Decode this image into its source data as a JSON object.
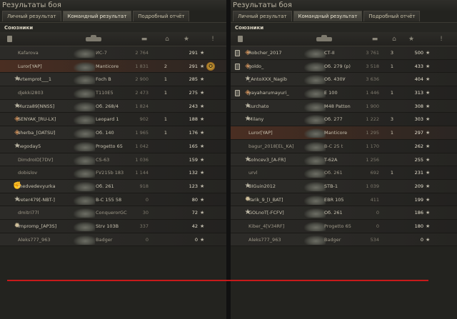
{
  "colors": {
    "accent": "#c81a1a",
    "self_row": "#4a2e22"
  },
  "left": {
    "title": "Результаты боя",
    "tabs": [
      "Личный результат",
      "Командный результат",
      "Подробный отчёт"
    ],
    "active_tab": 1,
    "team_label": "Союзники",
    "rows": [
      {
        "name": "Kafarova",
        "vehicle": "ИС-7",
        "dmg": "2 764",
        "kills": "",
        "xp": "291",
        "self": false,
        "dead": true,
        "icon": "none"
      },
      {
        "name": "Luror[YAP]",
        "vehicle": "Manticore",
        "dmg": "1 831",
        "kills": "2",
        "xp": "291",
        "self": true,
        "dead": false,
        "icon": "none",
        "medal": "1"
      },
      {
        "name": "Artemprot___1",
        "vehicle": "Foch B",
        "dmg": "2 900",
        "kills": "1",
        "xp": "285",
        "self": false,
        "dead": false,
        "icon": "star"
      },
      {
        "name": "djekki2803",
        "vehicle": "T110E5",
        "dmg": "2 473",
        "kills": "1",
        "xp": "275",
        "self": false,
        "dead": true,
        "icon": "none"
      },
      {
        "name": "Murza89[NNSS]",
        "vehicle": "Об. 268/4",
        "dmg": "1 824",
        "kills": "",
        "xp": "243",
        "self": false,
        "dead": false,
        "icon": "star"
      },
      {
        "name": "SENYAK_[RU-LX]",
        "vehicle": "Leopard 1",
        "dmg": "902",
        "kills": "1",
        "xp": "188",
        "self": false,
        "dead": false,
        "icon": "diamond"
      },
      {
        "name": "sherba_[OATSU]",
        "vehicle": "Об. 140",
        "dmg": "1 965",
        "kills": "1",
        "xp": "176",
        "self": false,
        "dead": false,
        "icon": "diamond"
      },
      {
        "name": "negoday5",
        "vehicle": "Progetto 65",
        "dmg": "1 042",
        "kills": "",
        "xp": "165",
        "self": false,
        "dead": false,
        "icon": "star"
      },
      {
        "name": "DimdroID[7DV]",
        "vehicle": "CS-63",
        "dmg": "1 036",
        "kills": "",
        "xp": "159",
        "self": false,
        "dead": true,
        "icon": "none"
      },
      {
        "name": "dobislov",
        "vehicle": "FV215b 183",
        "dmg": "1 144",
        "kills": "",
        "xp": "132",
        "self": false,
        "dead": true,
        "icon": "none"
      },
      {
        "name": "medvedevyurka",
        "vehicle": "Об. 261",
        "dmg": "918",
        "kills": "",
        "xp": "123",
        "self": false,
        "dead": false,
        "icon": "fist"
      },
      {
        "name": "veter479[-NBT-]",
        "vehicle": "B-C 155 58",
        "dmg": "0",
        "kills": "",
        "xp": "80",
        "self": false,
        "dead": false,
        "icon": "star"
      },
      {
        "name": "dmitri77l",
        "vehicle": "ConquerorGC",
        "dmg": "30",
        "kills": "",
        "xp": "72",
        "self": false,
        "dead": true,
        "icon": "none"
      },
      {
        "name": "Impromp_[AP3S]",
        "vehicle": "Strv 103B",
        "dmg": "337",
        "kills": "",
        "xp": "42",
        "self": false,
        "dead": false,
        "icon": "gear"
      },
      {
        "name": "Aleks777_963",
        "vehicle": "Badger",
        "dmg": "0",
        "kills": "",
        "xp": "0",
        "self": false,
        "dead": true,
        "icon": "none"
      }
    ]
  },
  "right": {
    "title": "Результаты боя",
    "tabs": [
      "Личный результат",
      "Командный результат",
      "Подробный отчёт"
    ],
    "active_tab": 1,
    "team_label": "Союзники",
    "rows": [
      {
        "name": "Robcher_2017",
        "vehicle": "СТ-II",
        "dmg": "3 761",
        "kills": "3",
        "xp": "500",
        "self": false,
        "dead": false,
        "icon": "diamond",
        "pi": true
      },
      {
        "name": "goldo_",
        "vehicle": "Об. 279 (р)",
        "dmg": "3 518",
        "kills": "1",
        "xp": "433",
        "self": false,
        "dead": false,
        "icon": "diamond",
        "pi": true
      },
      {
        "name": "_AntoXXX_Nagib",
        "vehicle": "Об. 430У",
        "dmg": "3 636",
        "kills": "",
        "xp": "404",
        "self": false,
        "dead": false,
        "icon": "star"
      },
      {
        "name": "yayaharumayuri_",
        "vehicle": "E 100",
        "dmg": "1 446",
        "kills": "1",
        "xp": "313",
        "self": false,
        "dead": false,
        "icon": "diamond",
        "pi": true
      },
      {
        "name": "kurchato",
        "vehicle": "M48 Patton",
        "dmg": "1 900",
        "kills": "",
        "xp": "308",
        "self": false,
        "dead": false,
        "icon": "star"
      },
      {
        "name": "Milany",
        "vehicle": "Об. 277",
        "dmg": "1 222",
        "kills": "3",
        "xp": "303",
        "self": false,
        "dead": false,
        "icon": "star"
      },
      {
        "name": "Luror[YAP]",
        "vehicle": "Manticore",
        "dmg": "1 295",
        "kills": "1",
        "xp": "297",
        "self": true,
        "dead": false,
        "icon": "none"
      },
      {
        "name": "bagur_2018[EL_KA]",
        "vehicle": "B-C 25 t",
        "dmg": "1 170",
        "kills": "",
        "xp": "262",
        "self": false,
        "dead": true,
        "icon": "none"
      },
      {
        "name": "solncev3_[A-FR]",
        "vehicle": "T-62A",
        "dmg": "1 256",
        "kills": "",
        "xp": "255",
        "self": false,
        "dead": false,
        "icon": "star"
      },
      {
        "name": "urvl",
        "vehicle": "Об. 261",
        "dmg": "692",
        "kills": "1",
        "xp": "231",
        "self": false,
        "dead": true,
        "icon": "none"
      },
      {
        "name": "BIGuin2012",
        "vehicle": "STB-1",
        "dmg": "1 039",
        "kills": "",
        "xp": "209",
        "self": false,
        "dead": false,
        "icon": "star"
      },
      {
        "name": "Yarik_9_[I_BAT]",
        "vehicle": "EBR 105",
        "dmg": "411",
        "kills": "",
        "xp": "199",
        "self": false,
        "dead": false,
        "icon": "gear"
      },
      {
        "name": "GOLnoT[-FCFV]",
        "vehicle": "Об. 261",
        "dmg": "0",
        "kills": "",
        "xp": "186",
        "self": false,
        "dead": false,
        "icon": "star"
      },
      {
        "name": "Kiber_4[V34RF]",
        "vehicle": "Progetto 65",
        "dmg": "0",
        "kills": "",
        "xp": "180",
        "self": false,
        "dead": true,
        "icon": "none"
      },
      {
        "name": "Aleks777_963",
        "vehicle": "Badger",
        "dmg": "534",
        "kills": "",
        "xp": "0",
        "self": false,
        "dead": true,
        "icon": "none"
      }
    ]
  },
  "icons": {
    "star": "★",
    "diamond": "◈",
    "gear": "✹",
    "fist": "✊",
    "xp": "★",
    "medal": "✪"
  }
}
